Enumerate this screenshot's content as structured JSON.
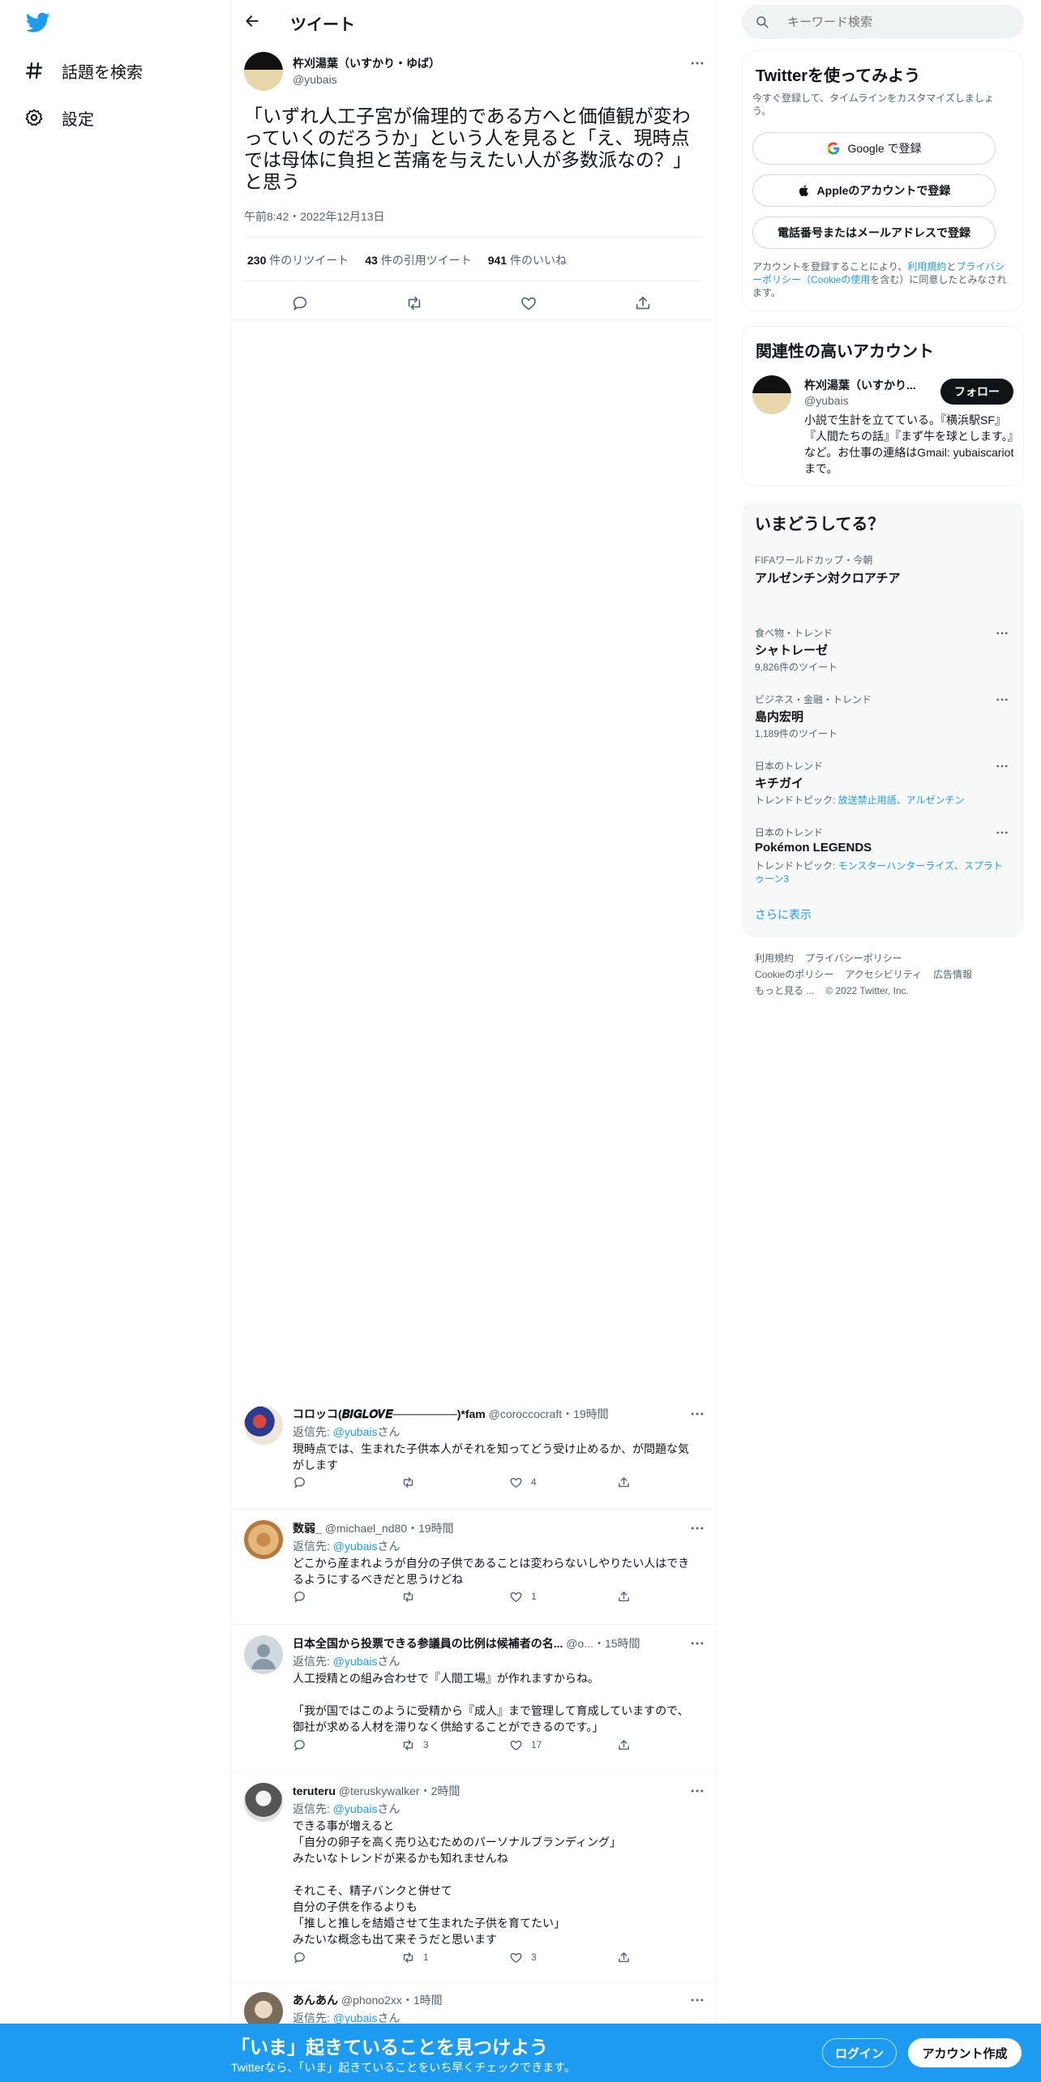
{
  "nav": {
    "explore_label": "話題を検索",
    "settings_label": "設定"
  },
  "header": {
    "title": "ツイート"
  },
  "tweet": {
    "author_name": "杵刈湯葉（いすかり・ゆば）",
    "author_handle": "@yubais",
    "text": "「いずれ人工子宮が倫理的である方へと価値観が変わっていくのだろうか」という人を見ると「え、現時点では母体に負担と苦痛を与えたい人が多数派なの？」と思う",
    "timestamp": "午前8:42・2022年12月13日",
    "retweets_count": "230",
    "retweets_label": "件のリツイート",
    "quotes_count": "43",
    "quotes_label": "件の引用ツイート",
    "likes_count": "941",
    "likes_label": "件のいいね"
  },
  "replies": [
    {
      "name": "コロッコ(𝑩𝑰𝑮𝑳𝑶𝑽𝑬────────)*fam",
      "handle": "@coroccocraft",
      "time": "・19時間",
      "replying_prefix": "返信先: ",
      "replying_to": "@yubais",
      "replying_suffix": "さん",
      "text": "現時点では、生まれた子供本人がそれを知ってどう受け止めるか、が問題な気がします",
      "reply_count": "",
      "retweet_count": "",
      "like_count": "4"
    },
    {
      "name": "数弱_",
      "handle": "@michael_nd80",
      "time": "・19時間",
      "replying_prefix": "返信先: ",
      "replying_to": "@yubais",
      "replying_suffix": "さん",
      "text": "どこから産まれようが自分の子供であることは変わらないしやりたい人はできるようにするべきだと思うけどね",
      "reply_count": "",
      "retweet_count": "",
      "like_count": "1"
    },
    {
      "name": "日本全国から投票できる参議員の比例は候補者の名...",
      "handle": "@o...",
      "time": "・15時間",
      "replying_prefix": "返信先: ",
      "replying_to": "@yubais",
      "replying_suffix": "さん",
      "text": "人工授精との組み合わせで『人間工場』が作れますからね。\n\n「我が国ではこのように受精から『成人』まで管理して育成していますので、御社が求める人材を滞りなく供給することができるのです。」",
      "reply_count": "",
      "retweet_count": "3",
      "like_count": "17"
    },
    {
      "name": "teruteru",
      "handle": "@teruskywalker",
      "time": "・2時間",
      "replying_prefix": "返信先: ",
      "replying_to": "@yubais",
      "replying_suffix": "さん",
      "text": "できる事が増えると\n「自分の卵子を高く売り込むためのパーソナルブランディング」\nみたいなトレンドが来るかも知れませんね\n\nそれこそ、精子バンクと併せて\n自分の子供を作るよりも\n「推しと推しを結婚させて生まれた子供を育てたい」\nみたいな概念も出て来そうだと思います",
      "reply_count": "",
      "retweet_count": "1",
      "like_count": "3"
    },
    {
      "name": "あんあん",
      "handle": "@phono2xx",
      "time": "・1時間",
      "replying_prefix": "返信先: ",
      "replying_to": "@yubais",
      "replying_suffix": "さん"
    }
  ],
  "search": {
    "placeholder": "キーワード検索"
  },
  "signup": {
    "title": "Twitterを使ってみよう",
    "subtitle": "今すぐ登録して、タイムラインをカスタマイズしましょう。",
    "google_label": "Google で登録",
    "apple_label": "Appleのアカウントで登録",
    "phone_label": "電話番号またはメールアドレスで登録",
    "terms_prefix": "アカウントを登録することにより、",
    "terms_link1": "利用規約",
    "terms_and": "と",
    "terms_link2": "プライバシーポリシー（Cookieの使用",
    "terms_suffix": "を含む）に同意したとみなされます。"
  },
  "related": {
    "title": "関連性の高いアカウント",
    "name": "杵刈湯葉（いすかり...",
    "handle": "@yubais",
    "follow_label": "フォロー",
    "bio": "小説で生計を立てている。『横浜駅SF』『人間たちの話』『まず牛を球とします。』など。お仕事の連絡はGmail: yubaiscariot まで。"
  },
  "trends": {
    "title": "いまどうしてる？",
    "items": [
      {
        "category": "FIFAワールドカップ・今朝",
        "name": "アルゼンチン対クロアチア",
        "sub": "",
        "sub_link": ""
      },
      {
        "category": "食べ物・トレンド",
        "name": "シャトレーゼ",
        "sub": "9,826件のツイート",
        "sub_link": ""
      },
      {
        "category": "ビジネス・金融・トレンド",
        "name": "島内宏明",
        "sub": "1,189件のツイート",
        "sub_link": ""
      },
      {
        "category": "日本のトレンド",
        "name": "キチガイ",
        "sub": "トレンドトピック: ",
        "sub_link": "放送禁止用語、アルゼンチン"
      },
      {
        "category": "日本のトレンド",
        "name": "Pokémon LEGENDS",
        "sub": "トレンドトピック: ",
        "sub_link": "モンスターハンターライズ、スプラトゥーン3"
      }
    ],
    "show_more": "さらに表示"
  },
  "footer": {
    "terms": "利用規約",
    "privacy": "プライバシーポリシー",
    "cookie": "Cookieのポリシー",
    "accessibility": "アクセシビリティ",
    "ads": "広告情報",
    "more": "もっと見る ...",
    "copyright": "© 2022 Twitter, Inc."
  },
  "bottombar": {
    "headline": "「いま」起きていることを見つけよう",
    "subline": "Twitterなら、「いま」起きていることをいち早くチェックできます。",
    "login_label": "ログイン",
    "signup_label": "アカウント作成"
  },
  "colors": {
    "accent": "#1d9bf0",
    "text": "#0f1419",
    "muted": "#536471"
  }
}
